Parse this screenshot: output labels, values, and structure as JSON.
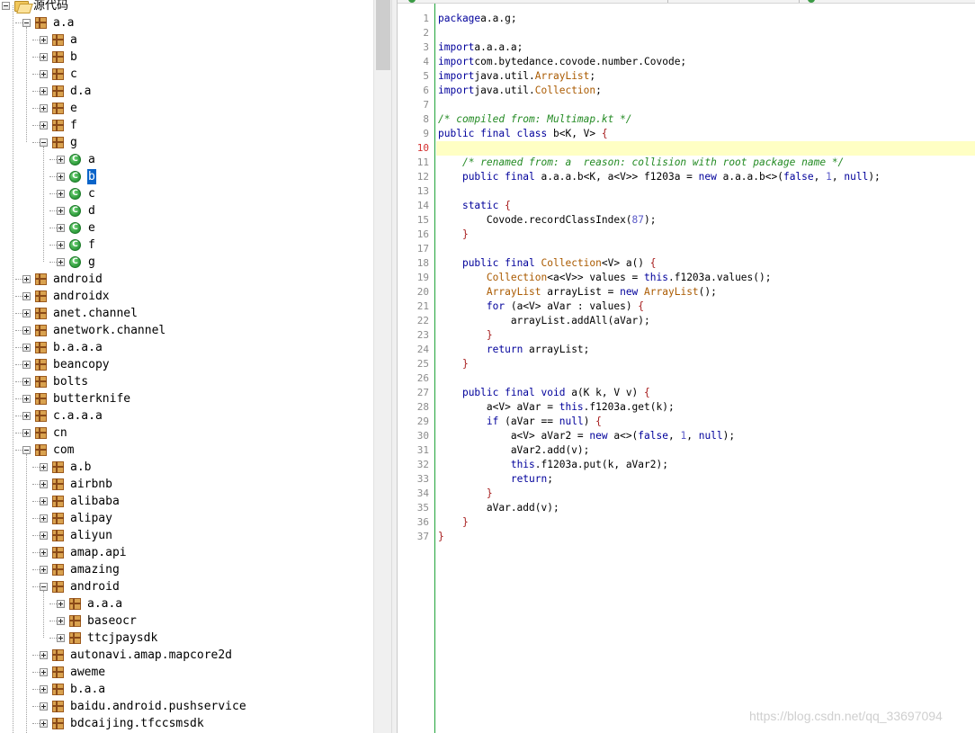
{
  "tree": {
    "root_label": "源代码",
    "items": [
      {
        "label": "a.a",
        "depth": 1,
        "icon": "package-icon",
        "expander": "minus"
      },
      {
        "label": "a",
        "depth": 2,
        "icon": "package-icon",
        "expander": "plus"
      },
      {
        "label": "b",
        "depth": 2,
        "icon": "package-icon",
        "expander": "plus"
      },
      {
        "label": "c",
        "depth": 2,
        "icon": "package-icon",
        "expander": "plus"
      },
      {
        "label": "d.a",
        "depth": 2,
        "icon": "package-icon",
        "expander": "plus"
      },
      {
        "label": "e",
        "depth": 2,
        "icon": "package-icon",
        "expander": "plus"
      },
      {
        "label": "f",
        "depth": 2,
        "icon": "package-icon",
        "expander": "plus"
      },
      {
        "label": "g",
        "depth": 2,
        "icon": "package-icon",
        "expander": "minus"
      },
      {
        "label": "a",
        "depth": 3,
        "icon": "class-icon",
        "expander": "plus"
      },
      {
        "label": "b",
        "depth": 3,
        "icon": "class-icon",
        "expander": "plus",
        "selected": true
      },
      {
        "label": "c",
        "depth": 3,
        "icon": "class-icon",
        "expander": "plus"
      },
      {
        "label": "d",
        "depth": 3,
        "icon": "class-icon",
        "expander": "plus"
      },
      {
        "label": "e",
        "depth": 3,
        "icon": "class-icon",
        "expander": "plus"
      },
      {
        "label": "f",
        "depth": 3,
        "icon": "class-icon",
        "expander": "plus"
      },
      {
        "label": "g",
        "depth": 3,
        "icon": "class-icon",
        "expander": "plus"
      },
      {
        "label": "android",
        "depth": 1,
        "icon": "package-icon",
        "expander": "plus"
      },
      {
        "label": "androidx",
        "depth": 1,
        "icon": "package-icon",
        "expander": "plus"
      },
      {
        "label": "anet.channel",
        "depth": 1,
        "icon": "package-icon",
        "expander": "plus"
      },
      {
        "label": "anetwork.channel",
        "depth": 1,
        "icon": "package-icon",
        "expander": "plus"
      },
      {
        "label": "b.a.a.a",
        "depth": 1,
        "icon": "package-icon",
        "expander": "plus"
      },
      {
        "label": "beancopy",
        "depth": 1,
        "icon": "package-icon",
        "expander": "plus"
      },
      {
        "label": "bolts",
        "depth": 1,
        "icon": "package-icon",
        "expander": "plus"
      },
      {
        "label": "butterknife",
        "depth": 1,
        "icon": "package-icon",
        "expander": "plus"
      },
      {
        "label": "c.a.a.a",
        "depth": 1,
        "icon": "package-icon",
        "expander": "plus"
      },
      {
        "label": "cn",
        "depth": 1,
        "icon": "package-icon",
        "expander": "plus"
      },
      {
        "label": "com",
        "depth": 1,
        "icon": "package-icon",
        "expander": "minus"
      },
      {
        "label": "a.b",
        "depth": 2,
        "icon": "package-icon",
        "expander": "plus"
      },
      {
        "label": "airbnb",
        "depth": 2,
        "icon": "package-icon",
        "expander": "plus"
      },
      {
        "label": "alibaba",
        "depth": 2,
        "icon": "package-icon",
        "expander": "plus"
      },
      {
        "label": "alipay",
        "depth": 2,
        "icon": "package-icon",
        "expander": "plus"
      },
      {
        "label": "aliyun",
        "depth": 2,
        "icon": "package-icon",
        "expander": "plus"
      },
      {
        "label": "amap.api",
        "depth": 2,
        "icon": "package-icon",
        "expander": "plus"
      },
      {
        "label": "amazing",
        "depth": 2,
        "icon": "package-icon",
        "expander": "plus"
      },
      {
        "label": "android",
        "depth": 2,
        "icon": "package-icon",
        "expander": "minus"
      },
      {
        "label": "a.a.a",
        "depth": 3,
        "icon": "package-icon",
        "expander": "plus"
      },
      {
        "label": "baseocr",
        "depth": 3,
        "icon": "package-icon",
        "expander": "plus"
      },
      {
        "label": "ttcjpaysdk",
        "depth": 3,
        "icon": "package-icon",
        "expander": "plus"
      },
      {
        "label": "autonavi.amap.mapcore2d",
        "depth": 2,
        "icon": "package-icon",
        "expander": "plus"
      },
      {
        "label": "aweme",
        "depth": 2,
        "icon": "package-icon",
        "expander": "plus"
      },
      {
        "label": "b.a.a",
        "depth": 2,
        "icon": "package-icon",
        "expander": "plus"
      },
      {
        "label": "baidu.android.pushservice",
        "depth": 2,
        "icon": "package-icon",
        "expander": "plus"
      },
      {
        "label": "bdcaijing.tfccsmsdk",
        "depth": 2,
        "icon": "package-icon",
        "expander": "plus"
      }
    ]
  },
  "editor": {
    "current_line": 10,
    "lines": [
      [
        [
          "kw",
          "package"
        ],
        [
          "",
          "a.a.g;"
        ]
      ],
      [],
      [
        [
          "kw",
          "import"
        ],
        [
          "",
          "a.a.a.a;"
        ]
      ],
      [
        [
          "kw",
          "import"
        ],
        [
          "",
          "com.bytedance.covode.number.Covode;"
        ]
      ],
      [
        [
          "kw",
          "import"
        ],
        [
          "",
          "java.util."
        ],
        [
          "ty",
          "ArrayList"
        ],
        [
          "",
          ";"
        ]
      ],
      [
        [
          "kw",
          "import"
        ],
        [
          "",
          "java.util."
        ],
        [
          "ty",
          "Collection"
        ],
        [
          "",
          ";"
        ]
      ],
      [],
      [
        [
          "cm",
          "/* compiled from: Multimap.kt */"
        ]
      ],
      [
        [
          "kw",
          "public final class"
        ],
        [
          "",
          " b<K, V> "
        ],
        [
          "br",
          "{"
        ]
      ],
      [],
      [
        [
          "",
          "    "
        ],
        [
          "cm",
          "/* renamed from: a  reason: collision with root package name */"
        ]
      ],
      [
        [
          "",
          "    "
        ],
        [
          "kw",
          "public final"
        ],
        [
          "",
          " a.a.a.b<K, a<V>> f1203a = "
        ],
        [
          "kw",
          "new"
        ],
        [
          "",
          " a.a.a.b<>("
        ],
        [
          "kw",
          "false"
        ],
        [
          "",
          ", "
        ],
        [
          "num",
          "1"
        ],
        [
          "",
          ", "
        ],
        [
          "kw",
          "null"
        ],
        [
          "",
          ");"
        ]
      ],
      [],
      [
        [
          "",
          "    "
        ],
        [
          "kw",
          "static"
        ],
        [
          "",
          " "
        ],
        [
          "br",
          "{"
        ]
      ],
      [
        [
          "",
          "        Covode.recordClassIndex("
        ],
        [
          "num",
          "87"
        ],
        [
          "",
          ");"
        ]
      ],
      [
        [
          "",
          "    "
        ],
        [
          "br",
          "}"
        ]
      ],
      [],
      [
        [
          "",
          "    "
        ],
        [
          "kw",
          "public final"
        ],
        [
          "",
          " "
        ],
        [
          "ty",
          "Collection"
        ],
        [
          "",
          "<V> a() "
        ],
        [
          "br",
          "{"
        ]
      ],
      [
        [
          "",
          "        "
        ],
        [
          "ty",
          "Collection"
        ],
        [
          "",
          "<a<V>> values = "
        ],
        [
          "kw",
          "this"
        ],
        [
          "",
          ".f1203a.values();"
        ]
      ],
      [
        [
          "",
          "        "
        ],
        [
          "ty",
          "ArrayList"
        ],
        [
          "",
          " arrayList = "
        ],
        [
          "kw",
          "new"
        ],
        [
          "",
          " "
        ],
        [
          "ty",
          "ArrayList"
        ],
        [
          "",
          "();"
        ]
      ],
      [
        [
          "",
          "        "
        ],
        [
          "kw",
          "for"
        ],
        [
          "",
          " (a<V> aVar : values) "
        ],
        [
          "br",
          "{"
        ]
      ],
      [
        [
          "",
          "            arrayList.addAll(aVar);"
        ]
      ],
      [
        [
          "",
          "        "
        ],
        [
          "br",
          "}"
        ]
      ],
      [
        [
          "",
          "        "
        ],
        [
          "kw",
          "return"
        ],
        [
          "",
          " arrayList;"
        ]
      ],
      [
        [
          "",
          "    "
        ],
        [
          "br",
          "}"
        ]
      ],
      [],
      [
        [
          "",
          "    "
        ],
        [
          "kw",
          "public final void"
        ],
        [
          "",
          " a(K k, V v) "
        ],
        [
          "br",
          "{"
        ]
      ],
      [
        [
          "",
          "        a<V> aVar = "
        ],
        [
          "kw",
          "this"
        ],
        [
          "",
          ".f1203a.get(k);"
        ]
      ],
      [
        [
          "",
          "        "
        ],
        [
          "kw",
          "if"
        ],
        [
          "",
          " (aVar == "
        ],
        [
          "kw",
          "null"
        ],
        [
          "",
          ") "
        ],
        [
          "br",
          "{"
        ]
      ],
      [
        [
          "",
          "            a<V> aVar2 = "
        ],
        [
          "kw",
          "new"
        ],
        [
          "",
          " a<>("
        ],
        [
          "kw",
          "false"
        ],
        [
          "",
          ", "
        ],
        [
          "num",
          "1"
        ],
        [
          "",
          ", "
        ],
        [
          "kw",
          "null"
        ],
        [
          "",
          ");"
        ]
      ],
      [
        [
          "",
          "            aVar2.add(v);"
        ]
      ],
      [
        [
          "",
          "            "
        ],
        [
          "kw",
          "this"
        ],
        [
          "",
          ".f1203a.put(k, aVar2);"
        ]
      ],
      [
        [
          "",
          "            "
        ],
        [
          "kw",
          "return"
        ],
        [
          "",
          ";"
        ]
      ],
      [
        [
          "",
          "        "
        ],
        [
          "br",
          "}"
        ]
      ],
      [
        [
          "",
          "        aVar.add(v);"
        ]
      ],
      [
        [
          "",
          "    "
        ],
        [
          "br",
          "}"
        ]
      ],
      [
        [
          "br",
          "}"
        ]
      ]
    ]
  },
  "watermark": "https://blog.csdn.net/qq_33697094"
}
